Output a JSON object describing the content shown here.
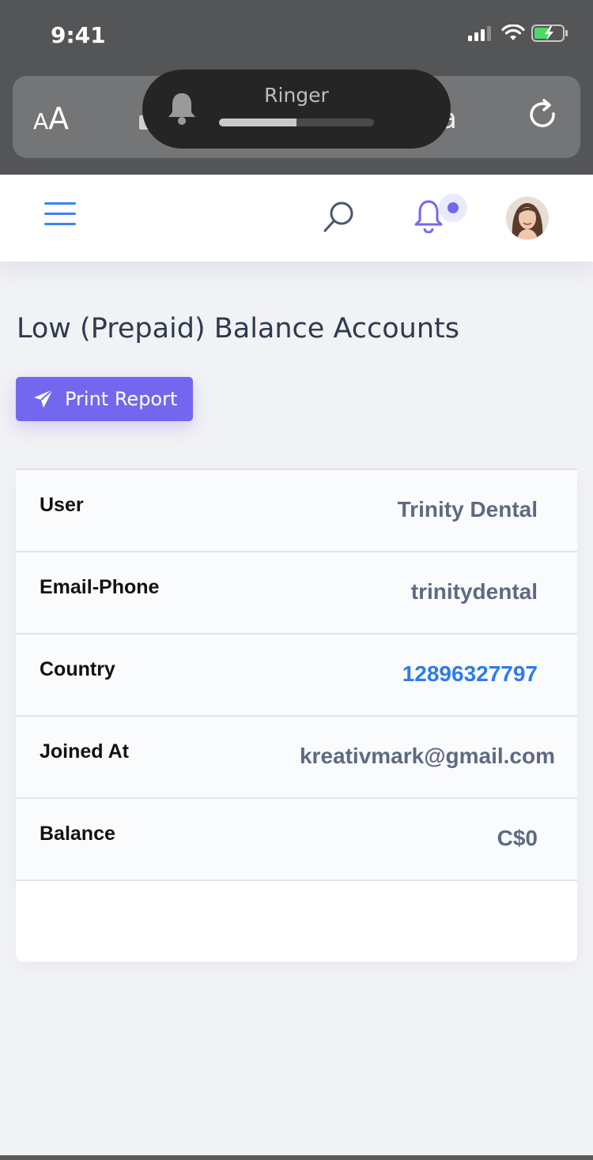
{
  "status_bar": {
    "time": "9:41"
  },
  "browser": {
    "text_size_label_small": "A",
    "text_size_label_big": "A",
    "url_peek": "a"
  },
  "ringer": {
    "label": "Ringer",
    "level_percent": 50
  },
  "header": {
    "notification_dot": true
  },
  "page": {
    "title": "Low (Prepaid) Balance Accounts",
    "print_button": "Print Report"
  },
  "details": [
    {
      "key": "User",
      "value": "Trinity Dental"
    },
    {
      "key": "Email-Phone",
      "value": "trinitydental"
    },
    {
      "key": "Country",
      "value": "12896327797"
    },
    {
      "key": "Joined At",
      "value": "kreativmark@gmail.com"
    },
    {
      "key": "Balance",
      "value": "C$0"
    }
  ],
  "colors": {
    "accent": "#7367f0",
    "link": "#2e7be6",
    "menu": "#3b82f6"
  }
}
